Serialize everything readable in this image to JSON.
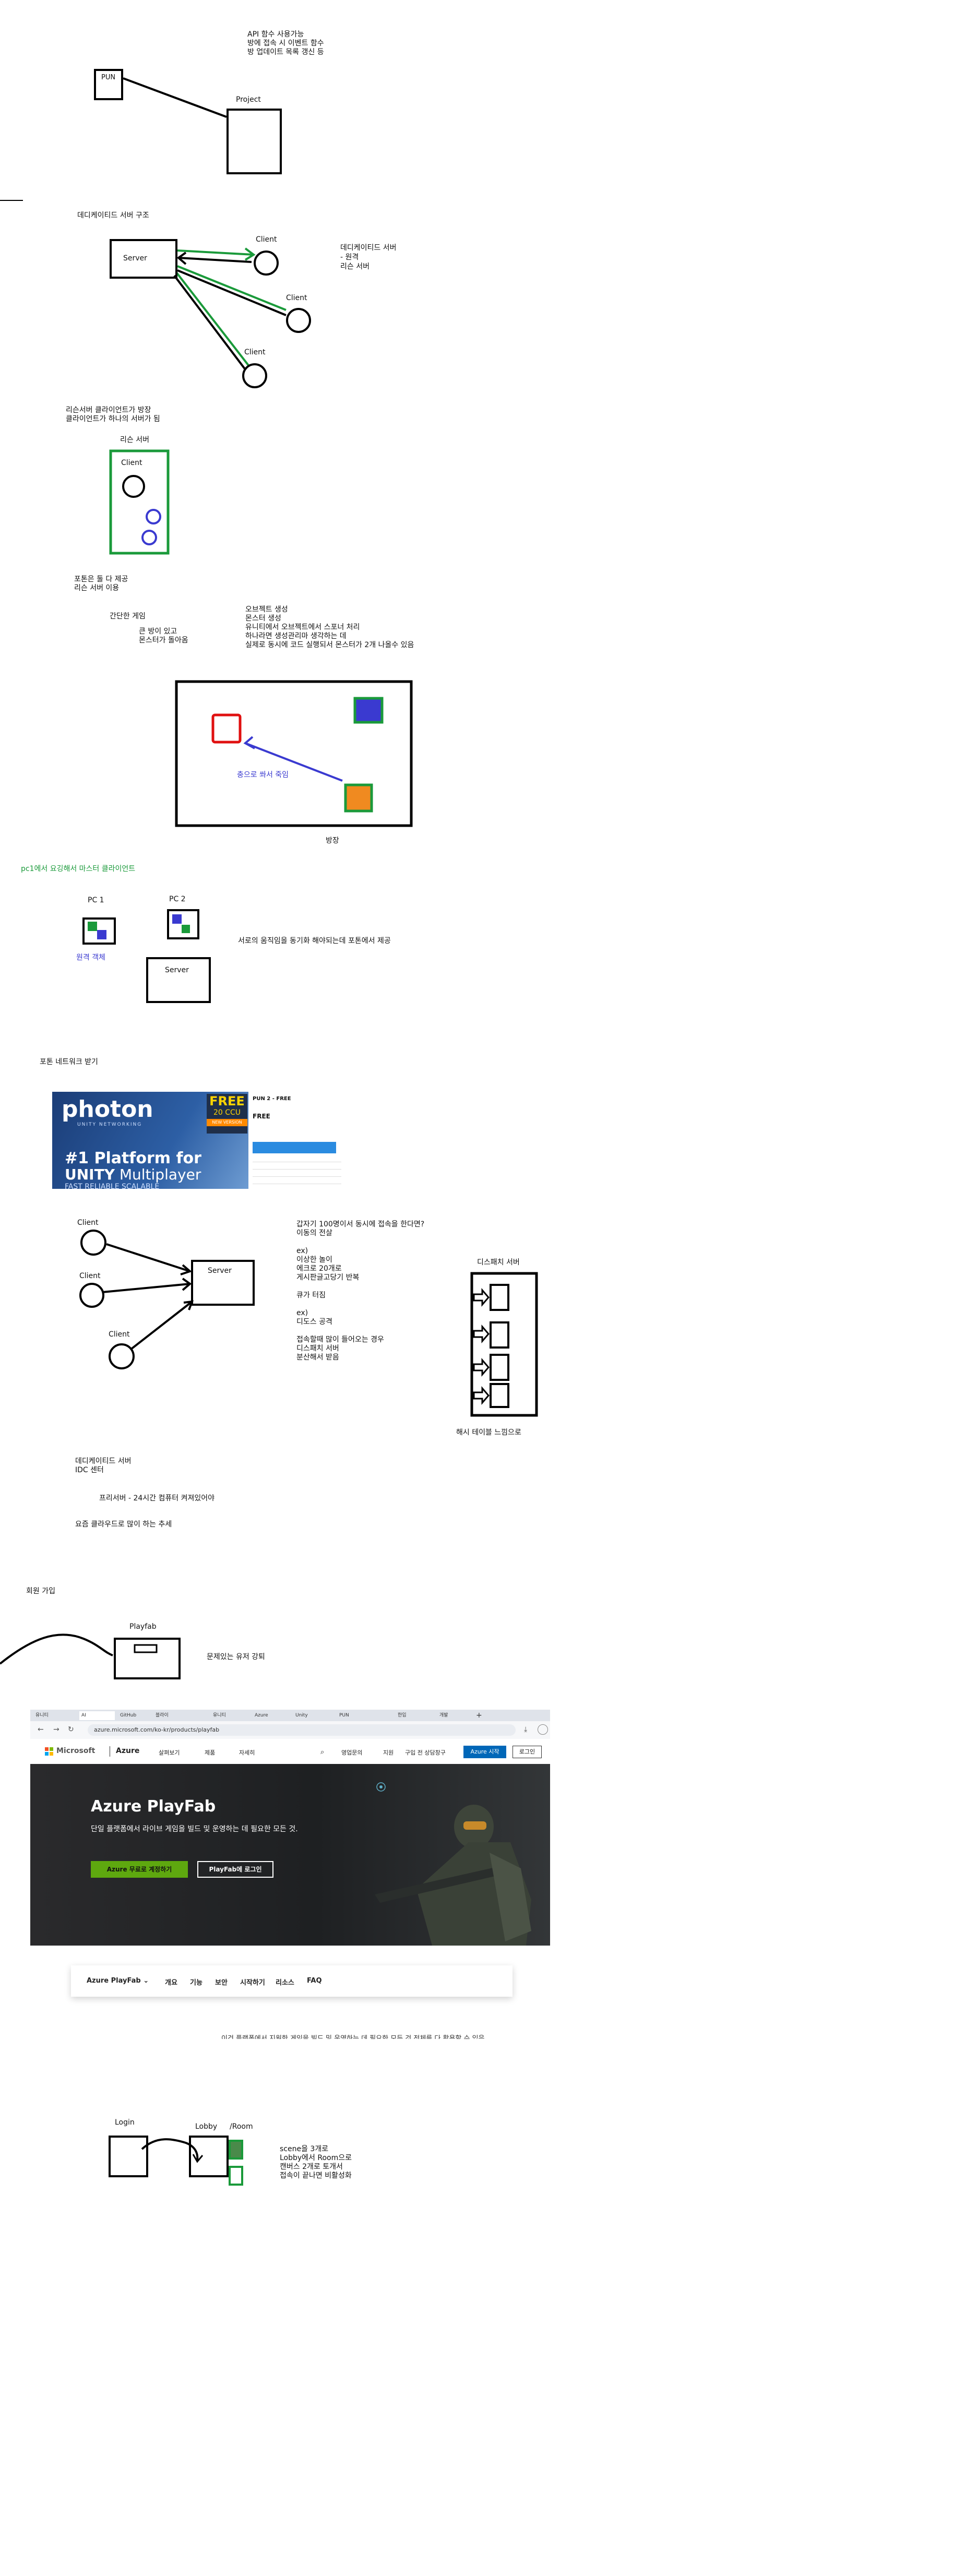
{
  "notes": {
    "api_lines": [
      "API 함수 사용가능",
      "방에 접속 시 이벤트 함수",
      "방 업데이트 목록 갱신 등"
    ],
    "pun": "PUN",
    "project": "Project",
    "dedicated_title": "데디케이티드 서버 구조",
    "server": "Server",
    "client": "Client",
    "dedicated_side": [
      "데디케이티드 서버",
      "- 원격",
      "리슨 서버"
    ],
    "listen_desc": [
      "리슨서버 클라이언트가 방장",
      "클라이언트가 하나의 서버가 됨"
    ],
    "listen_label": "리슨 서버",
    "photon_both": [
      "포톤은 둘 다 제공",
      "리슨 서버 이용"
    ],
    "simple_game": "간단한 게임",
    "simple_game_sub": [
      "큰 방이 있고",
      "몬스터가 돌아옴"
    ],
    "object_notes": [
      "오브젝트 생성",
      "몬스터 생성",
      "유니티에서 오브젝트에서 스포너 처리",
      "하나라면 생성관리마 생각하는 데",
      "실제로 동시에 코드 실행되서 몬스터가 2개 나올수 있음"
    ],
    "owner_label": "방장",
    "kill_label": "충으로 쏴서 죽임",
    "sync_title": "pc1에서 요깅해서 마스터 클라이언트",
    "pc1": "PC 1",
    "pc2": "PC 2",
    "remote_object": "원격 객체",
    "sync_desc": "서로의 움직임을 동기화 해야되는데 포톤에서 제공",
    "photon_network": "포톤 네트워크 받기",
    "concurrent_notes": [
      "갑자기 100명이서 동시에 접속을 한다면?",
      "이동의 전살",
      "",
      "ex)",
      "이상한 놀이",
      "에크로 20개로",
      "게시판글고당기 반복",
      "",
      "큐가 터짐",
      "",
      "ex)",
      "디도스 공격",
      "",
      "접속할때 많이 들어오는 경우",
      "디스패치 서버",
      "분산해서 받음"
    ],
    "dispatch_title": "디스패치 서버",
    "hash_table": "해시 테이블 느낌으로",
    "idc_notes": [
      "데디케이티드 서버",
      "IDC 센터"
    ],
    "free_server": "프리서버 - 24시간 컴퓨터 켜져있어야",
    "cloud_trend": "요즘 클라우드로 많이 하는 추세",
    "signup": "회원 가입",
    "playfab": "Playfab",
    "security": "문제있는 유저 강퇴",
    "clipped_text": "이건 플랫폼에서 지원한 게임을 빌드 및 운영하는 데 필요한 모든 것 전체를 다 활용할 수 있음",
    "login": "Login",
    "lobby": "Lobby",
    "room": "Room",
    "scene_notes": [
      "scene을 3개로",
      "Lobby에서 Room으로",
      "캔버스 2개로 토개서",
      "접속이 끝나면 비활성화"
    ]
  },
  "photon_image": {
    "brand": "photon",
    "brand_sub": "UNITY NETWORKING",
    "free_big": "FREE",
    "free_ccu": "20 CCU",
    "new_version": "NEW VERSION",
    "tagline": "#1 Platform for",
    "tagline2": "UNITY",
    "tagline2b": " Multiplayer",
    "tagline3": "FAST  RELIABLE  SCALABLE",
    "asset_title": "PUN 2 - FREE",
    "price": "FREE"
  },
  "browser": {
    "tabs": [
      "유니티",
      "AI",
      "GitHub",
      "블라이",
      "유니티",
      "Azure",
      "Unity",
      "PUN",
      "한입",
      "개발"
    ],
    "url": "azure.microsoft.com/ko-kr/products/playfab",
    "nav_brand": "Microsoft",
    "nav_product": "Azure",
    "nav_items": [
      "살펴보기",
      "제품",
      "자세히"
    ],
    "nav_right": [
      "영업문의",
      "지원",
      "구입 전 상담창구"
    ],
    "cta_nav": "Azure 시작",
    "login_nav": "로그인",
    "hero_title": "Azure PlayFab",
    "hero_desc": "단일 플랫폼에서 라이브 게임을 빌드 및 운영하는 데 필요한 모든 것.",
    "hero_btn1": "Azure 무료로 계정하기",
    "hero_btn2": "PlayFab에 로그인",
    "sub_brand": "Azure PlayFab",
    "sub_items": [
      "개요",
      "기능",
      "보안",
      "시작하기",
      "리소스",
      "FAQ"
    ]
  }
}
